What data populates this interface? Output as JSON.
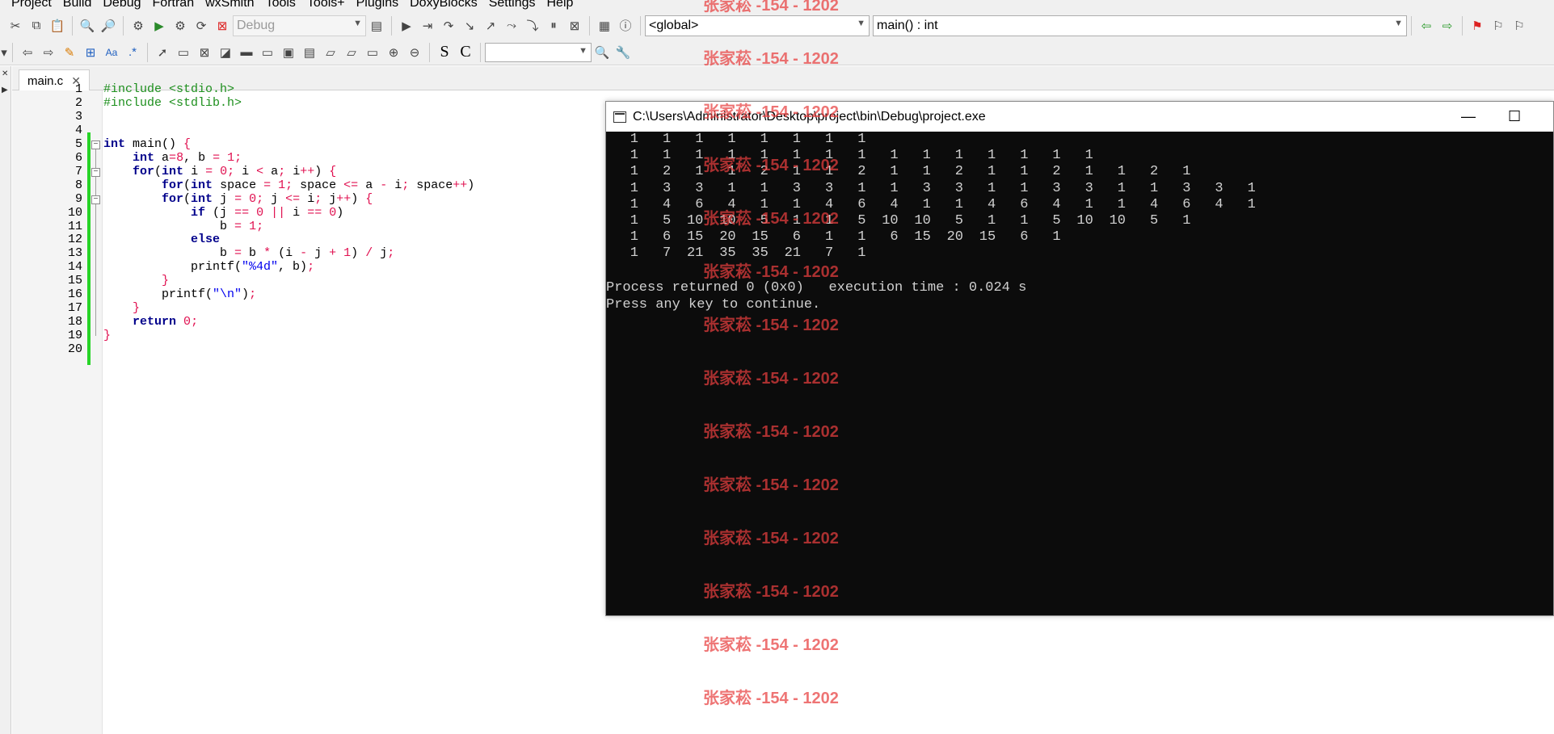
{
  "menu": [
    "Project",
    "Build",
    "Debug",
    "Fortran",
    "wxSmith",
    "Tools",
    "Tools+",
    "Plugins",
    "DoxyBlocks",
    "Settings",
    "Help"
  ],
  "toolbar": {
    "build_target": "Debug",
    "scope": "<global>",
    "function": "main() : int",
    "search_value": ""
  },
  "editor": {
    "tab_label": "main.c",
    "tab_close": "✕",
    "line_numbers": [
      "1",
      "2",
      "3",
      "4",
      "5",
      "6",
      "7",
      "8",
      "9",
      "10",
      "11",
      "12",
      "13",
      "14",
      "15",
      "16",
      "17",
      "18",
      "19",
      "20"
    ],
    "lines": [
      "#include <stdio.h>",
      "#include <stdlib.h>",
      "",
      "",
      "int main() {",
      "    int a=8, b = 1;",
      "    for(int i = 0; i < a; i++) {",
      "        for(int space = 1; space <= a - i; space++)",
      "        for(int j = 0; j <= i; j++) {",
      "            if (j == 0 || i == 0)",
      "                b = 1;",
      "            else",
      "                b = b * (i - j + 1) / j;",
      "            printf(\"%4d\", b);",
      "        }",
      "        printf(\"\\n\");",
      "    }",
      "    return 0;",
      "}",
      ""
    ]
  },
  "console": {
    "title": "C:\\Users\\Administrator\\Desktop\\project\\bin\\Debug\\project.exe",
    "minimize": "—",
    "maximize": "☐",
    "rows": [
      [
        "1",
        "1",
        "1",
        "1",
        "1",
        "1",
        "1",
        "1"
      ],
      [
        "1",
        "1",
        "1",
        "1",
        "1",
        "1",
        "1",
        "1",
        "1",
        "1",
        "1",
        "1",
        "1",
        "1",
        "1"
      ],
      [
        "1",
        "2",
        "1",
        "1",
        "2",
        "1",
        "1",
        "2",
        "1",
        "1",
        "2",
        "1",
        "1",
        "2",
        "1",
        "1",
        "2",
        "1"
      ],
      [
        "1",
        "3",
        "3",
        "1",
        "1",
        "3",
        "3",
        "1",
        "1",
        "3",
        "3",
        "1",
        "1",
        "3",
        "3",
        "1",
        "1",
        "3",
        "3",
        "1"
      ],
      [
        "1",
        "4",
        "6",
        "4",
        "1",
        "1",
        "4",
        "6",
        "4",
        "1",
        "1",
        "4",
        "6",
        "4",
        "1",
        "1",
        "4",
        "6",
        "4",
        "1"
      ],
      [
        "1",
        "5",
        "10",
        "10",
        "5",
        "1",
        "1",
        "5",
        "10",
        "10",
        "5",
        "1",
        "1",
        "5",
        "10",
        "10",
        "5",
        "1"
      ],
      [
        "1",
        "6",
        "15",
        "20",
        "15",
        "6",
        "1",
        "1",
        "6",
        "15",
        "20",
        "15",
        "6",
        "1"
      ],
      [
        "1",
        "7",
        "21",
        "35",
        "35",
        "21",
        "7",
        "1"
      ]
    ],
    "lines": [
      "Process returned 0 (0x0)   execution time : 0.024 s",
      "Press any key to continue."
    ]
  },
  "watermark": "张家菘 -154 - 1202"
}
